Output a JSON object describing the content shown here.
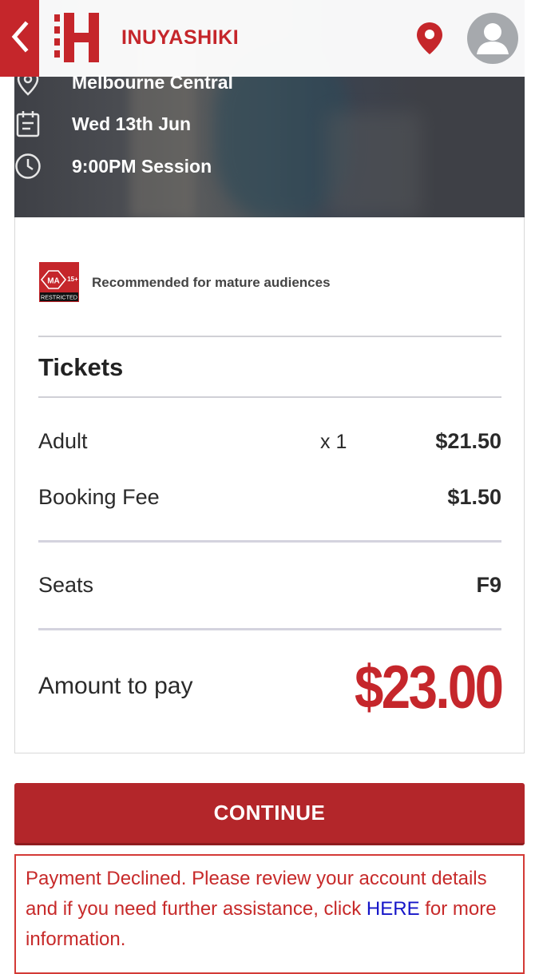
{
  "header": {
    "app_title": "INUYASHIKI",
    "back_icon": "chevron-left-icon",
    "location_icon": "location-pin-icon",
    "avatar_icon": "user-avatar-icon",
    "brand_color": "#c5262b"
  },
  "session": {
    "cinema": "Melbourne Central",
    "date": "Wed 13th Jun",
    "time": "9:00PM Session"
  },
  "rating": {
    "code": "MA",
    "age": "15+",
    "label": "RESTRICTED",
    "description": "Recommended for mature audiences"
  },
  "tickets": {
    "title": "Tickets",
    "items": [
      {
        "label": "Adult",
        "qty": "x 1",
        "price": "$21.50"
      },
      {
        "label": "Booking Fee",
        "qty": "",
        "price": "$1.50"
      }
    ],
    "seats_label": "Seats",
    "seats_value": "F9",
    "amount_label": "Amount to pay",
    "amount_value": "$23.00"
  },
  "actions": {
    "continue_label": "CONTINUE"
  },
  "error": {
    "text_before": "Payment Declined. Please review your account details and if you need further assistance, click ",
    "link_text": "HERE",
    "text_after": " for more information."
  }
}
